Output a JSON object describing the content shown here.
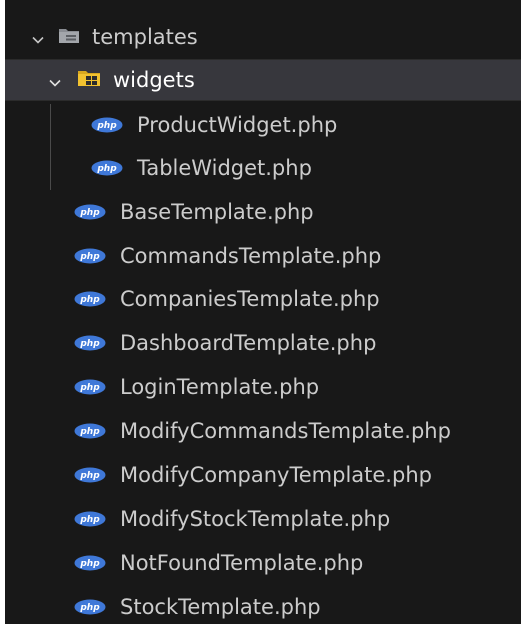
{
  "explorer": {
    "clipped_row_text": "· · · · · · · · · ·",
    "colors": {
      "background": "#181818",
      "selected_row": "#37373d",
      "text": "#cccccc",
      "php_icon": "#3f78d8",
      "templates_folder_icon": "#8a8d93",
      "widgets_folder_icon": "#f2c230"
    },
    "folders": {
      "templates": {
        "label": "templates",
        "icon": "folder-icon",
        "expanded": true
      },
      "widgets": {
        "label": "widgets",
        "icon": "folder-widgets-icon",
        "expanded": true,
        "selected": true
      }
    },
    "widget_files": [
      {
        "label": "ProductWidget.php",
        "icon": "php-icon"
      },
      {
        "label": "TableWidget.php",
        "icon": "php-icon"
      }
    ],
    "template_files": [
      {
        "label": "BaseTemplate.php",
        "icon": "php-icon"
      },
      {
        "label": "CommandsTemplate.php",
        "icon": "php-icon"
      },
      {
        "label": "CompaniesTemplate.php",
        "icon": "php-icon"
      },
      {
        "label": "DashboardTemplate.php",
        "icon": "php-icon"
      },
      {
        "label": "LoginTemplate.php",
        "icon": "php-icon"
      },
      {
        "label": "ModifyCommandsTemplate.php",
        "icon": "php-icon"
      },
      {
        "label": "ModifyCompanyTemplate.php",
        "icon": "php-icon"
      },
      {
        "label": "ModifyStockTemplate.php",
        "icon": "php-icon"
      },
      {
        "label": "NotFoundTemplate.php",
        "icon": "php-icon"
      },
      {
        "label": "StockTemplate.php",
        "icon": "php-icon"
      }
    ]
  }
}
